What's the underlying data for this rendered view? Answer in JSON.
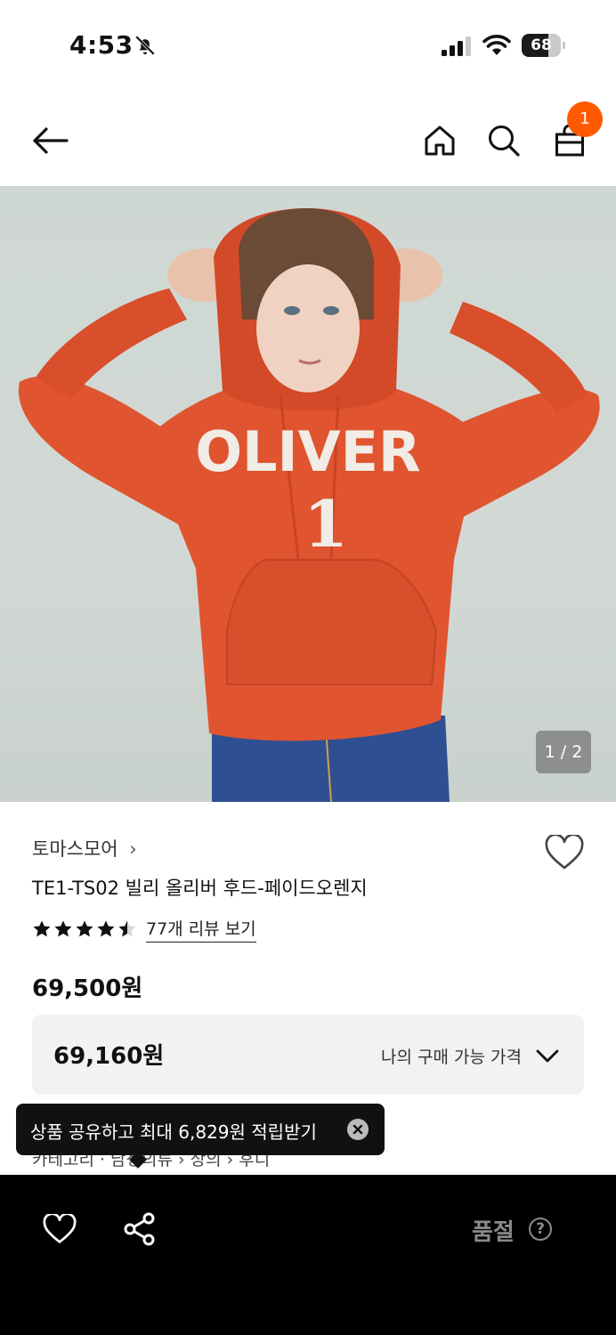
{
  "status_bar": {
    "time": "4:53",
    "battery_level": 68,
    "battery_text": "68",
    "icons": [
      "bell-off-icon",
      "cellular-signal-icon",
      "wifi-icon",
      "battery-icon"
    ]
  },
  "header": {
    "icons": [
      "back-arrow-icon",
      "home-icon",
      "search-icon",
      "shopping-bag-icon"
    ],
    "cart_count": "1",
    "badge_color": "#ff5a00"
  },
  "product_image": {
    "chest_text": "OLIVER",
    "number_text": "1",
    "counter": "1 / 2"
  },
  "product": {
    "brand": "토마스모어",
    "brand_chevron": "›",
    "name": "TE1-TS02 빌리 올리버 후드-페이드오렌지",
    "rating": 4.5,
    "review_link": "77개 리뷰 보기",
    "price": "69,500원",
    "my_price": "69,160원",
    "my_price_label": "나의 구매 가능 가격",
    "category": "카테고리 · 남성의류 › 상의 › 후디"
  },
  "toast": {
    "text": "상품 공유하고 최대 6,829원 적립받기"
  },
  "bottom_bar": {
    "soldout_label": "품절",
    "help_symbol": "?"
  }
}
